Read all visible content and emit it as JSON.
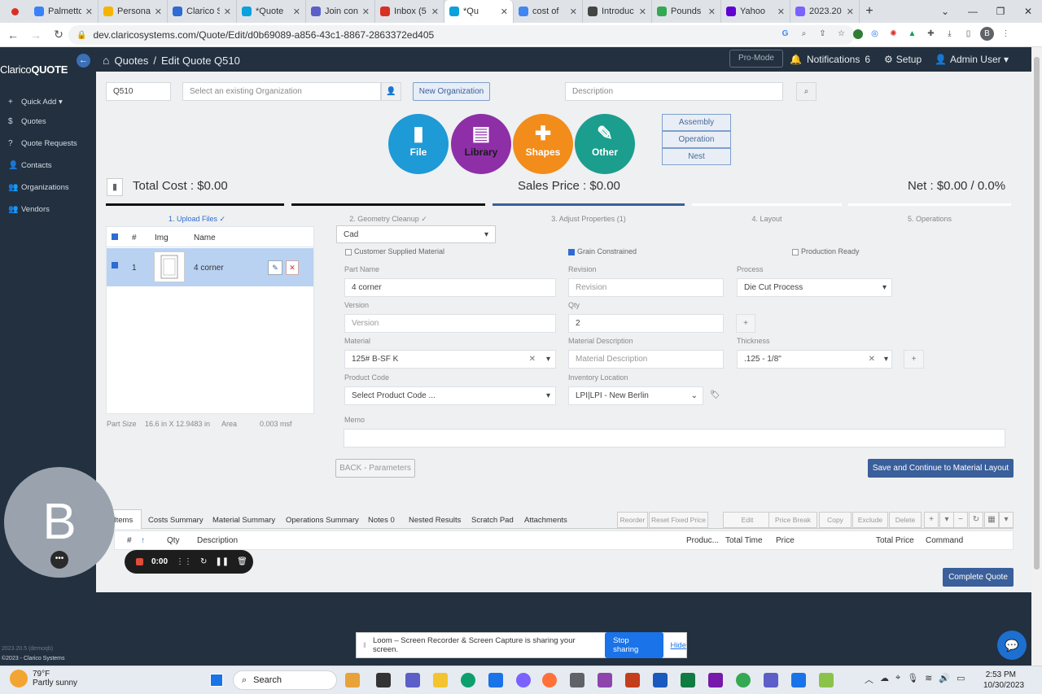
{
  "browser": {
    "tabs": [
      {
        "label": "Palmetto",
        "color": "#3b82f6"
      },
      {
        "label": "Personal",
        "color": "#f4b400"
      },
      {
        "label": "Clarico S",
        "color": "#2f6bd0"
      },
      {
        "label": "*Quote",
        "color": "#0aa1dd"
      },
      {
        "label": "Join con",
        "color": "#5b5fc7"
      },
      {
        "label": "Inbox (5",
        "color": "#d93025"
      },
      {
        "label": "*Qu",
        "color": "#0aa1dd",
        "active": true
      },
      {
        "label": "cost of",
        "color": "#4285f4"
      },
      {
        "label": "Introduc",
        "color": "#444444"
      },
      {
        "label": "Pounds",
        "color": "#34a853"
      },
      {
        "label": "Yahoo",
        "color": "#6001d2"
      },
      {
        "label": "2023.20",
        "color": "#7b61ff"
      }
    ],
    "url": "dev.claricosystems.com/Quote/Edit/d0b69089-a856-43c1-8867-2863372ed405",
    "profile": "B"
  },
  "sidebar": {
    "brand_prefix": "Clarico",
    "brand_bold": "QUOTE",
    "items": [
      {
        "label": "Quick Add ▾",
        "icon": "+"
      },
      {
        "label": "Quotes",
        "icon": "$"
      },
      {
        "label": "Quote Requests",
        "icon": "?"
      },
      {
        "label": "Contacts",
        "icon": "👤"
      },
      {
        "label": "Organizations",
        "icon": "👥"
      },
      {
        "label": "Vendors",
        "icon": "👥"
      }
    ],
    "version": "2023.20.5 (demoqb)",
    "copyright": "©2023 - Clarico Systems"
  },
  "topbar": {
    "crumb1": "Quotes",
    "sep": "/",
    "crumb2": "Edit Quote Q510",
    "promode": "Pro-Mode",
    "notifications": "Notifications",
    "notif_count": "6",
    "setup": "Setup",
    "user": "Admin User ▾"
  },
  "quote": {
    "number": "Q510",
    "org_placeholder": "Select an existing Organization",
    "new_org": "New Organization",
    "desc_placeholder": "Description"
  },
  "actions": [
    {
      "label": "File",
      "color": "#1e9ad6",
      "glyph": "▮"
    },
    {
      "label": "Library",
      "color": "#8e2fa8",
      "glyph": "▤"
    },
    {
      "label": "Shapes",
      "color": "#f28c1a",
      "glyph": "✚"
    },
    {
      "label": "Other",
      "color": "#1b9e8e",
      "glyph": "✎"
    }
  ],
  "side_buttons": [
    "Assembly",
    "Operation",
    "Nest"
  ],
  "totals": {
    "total_cost": "Total Cost : $0.00",
    "sales_price": "Sales Price : $0.00",
    "net": "Net : $0.00 / 0.0%"
  },
  "steps": [
    {
      "label": "1. Upload Files ✓",
      "color": "#2f6bd0"
    },
    {
      "label": "2. Geometry Cleanup ✓",
      "color": "#888888"
    },
    {
      "label": "3. Adjust Properties (1)",
      "color": "#888888"
    },
    {
      "label": "4. Layout",
      "color": "#888888"
    },
    {
      "label": "5. Operations",
      "color": "#888888"
    }
  ],
  "parts_table": {
    "headers": [
      "#",
      "Img",
      "Name"
    ],
    "rows": [
      {
        "num": "1",
        "name": "4 corner"
      }
    ],
    "part_size_label": "Part Size",
    "part_size": "16.6 in X 12.9483 in",
    "area_label": "Area",
    "area": "0.003 msf"
  },
  "form": {
    "source": "Cad",
    "customer_supplied": "Customer Supplied Material",
    "grain_constrained": "Grain Constrained",
    "production_ready": "Production Ready",
    "part_name_label": "Part Name",
    "part_name": "4 corner",
    "revision_label": "Revision",
    "revision_ph": "Revision",
    "process_label": "Process",
    "process": "Die Cut Process",
    "version_label": "Version",
    "version_ph": "Version",
    "qty_label": "Qty",
    "qty": "2",
    "material_label": "Material",
    "material": "125# B-SF K",
    "matdesc_label": "Material Description",
    "matdesc_ph": "Material Description",
    "thickness_label": "Thickness",
    "thickness": ".125 - 1/8\"",
    "product_code_label": "Product Code",
    "product_code": "Select Product Code ...",
    "inventory_label": "Inventory Location",
    "inventory": "LPI|LPI - New Berlin",
    "memo_label": "Memo",
    "back": "BACK - Parameters",
    "save": "Save and Continue to Material Layout"
  },
  "bottom": {
    "tabs": [
      "Items",
      "Costs Summary",
      "Material Summary",
      "Operations Summary",
      "Notes 0",
      "Nested Results",
      "Scratch Pad",
      "Attachments"
    ],
    "toolbar": [
      "Reorder",
      "Reset Fixed Price",
      "Edit",
      "Price Break",
      "Copy",
      "Exclude",
      "Delete"
    ],
    "headers": [
      "#",
      "↑",
      "Qty",
      "Description",
      "Produc...",
      "Total Time",
      "Price",
      "Total Price",
      "Command"
    ],
    "complete": "Complete Quote"
  },
  "overlay": {
    "avatar": "B",
    "timer": "0:00",
    "loom_text": "Loom – Screen Recorder & Screen Capture is sharing your screen.",
    "stop": "Stop sharing",
    "hide": "Hide"
  },
  "taskbar": {
    "temp": "79°F",
    "weather": "Partly sunny",
    "search": "Search",
    "time": "2:53 PM",
    "date": "10/30/2023"
  }
}
